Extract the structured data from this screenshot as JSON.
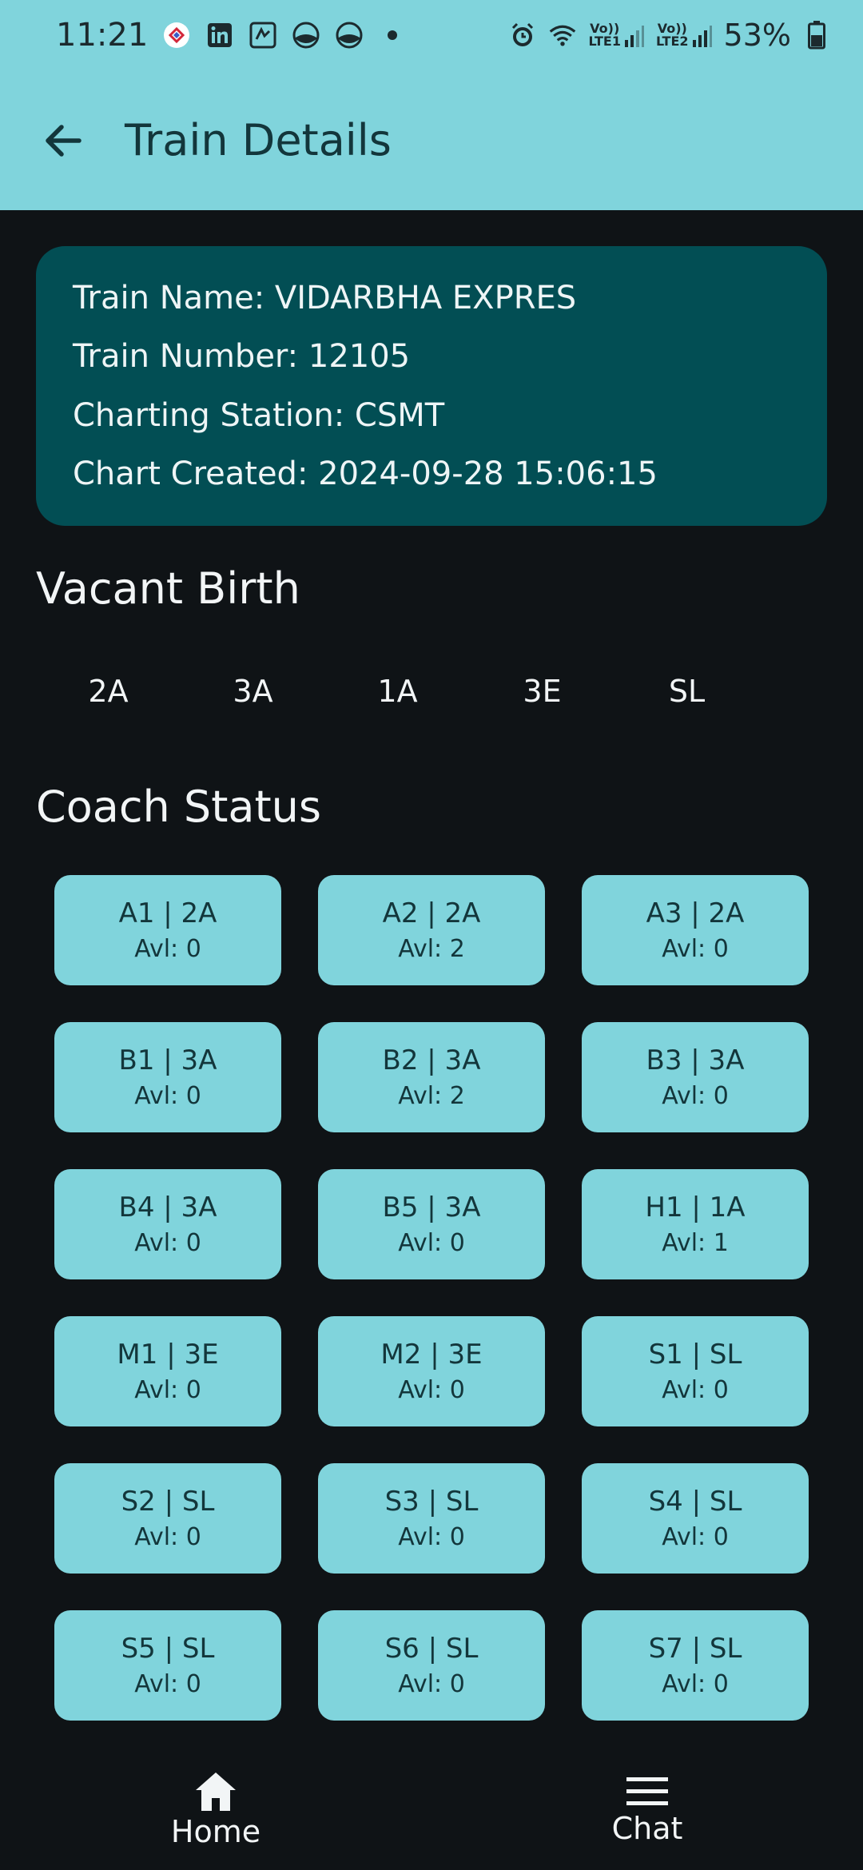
{
  "status_bar": {
    "time": "11:21",
    "battery": "53%",
    "lte1": "LTE1",
    "lte2": "LTE2",
    "vo": "Vo))"
  },
  "app_bar": {
    "title": "Train Details"
  },
  "train_info": {
    "name": "Train Name: VIDARBHA EXPRES",
    "number": "Train Number: 12105",
    "station": "Charting Station: CSMT",
    "created": "Chart Created: 2024-09-28 15:06:15"
  },
  "vacant": {
    "title": "Vacant Birth",
    "tabs": [
      "2A",
      "3A",
      "1A",
      "3E",
      "SL"
    ]
  },
  "coach_status": {
    "title": "Coach Status",
    "coaches": [
      {
        "name": "A1 | 2A",
        "avl": "Avl: 0"
      },
      {
        "name": "A2 | 2A",
        "avl": "Avl: 2"
      },
      {
        "name": "A3 | 2A",
        "avl": "Avl: 0"
      },
      {
        "name": "B1 | 3A",
        "avl": "Avl: 0"
      },
      {
        "name": "B2 | 3A",
        "avl": "Avl: 2"
      },
      {
        "name": "B3 | 3A",
        "avl": "Avl: 0"
      },
      {
        "name": "B4 | 3A",
        "avl": "Avl: 0"
      },
      {
        "name": "B5 | 3A",
        "avl": "Avl: 0"
      },
      {
        "name": "H1 | 1A",
        "avl": "Avl: 1"
      },
      {
        "name": "M1 | 3E",
        "avl": "Avl: 0"
      },
      {
        "name": "M2 | 3E",
        "avl": "Avl: 0"
      },
      {
        "name": "S1 | SL",
        "avl": "Avl: 0"
      },
      {
        "name": "S2 | SL",
        "avl": "Avl: 0"
      },
      {
        "name": "S3 | SL",
        "avl": "Avl: 0"
      },
      {
        "name": "S4 | SL",
        "avl": "Avl: 0"
      },
      {
        "name": "S5 | SL",
        "avl": "Avl: 0"
      },
      {
        "name": "S6 | SL",
        "avl": "Avl: 0"
      },
      {
        "name": "S7 | SL",
        "avl": "Avl: 0"
      }
    ]
  },
  "bottom_nav": {
    "home_label": "Home",
    "chat_label": "Chat"
  },
  "colors": {
    "accent": "#80d4dc",
    "card": "#024e54",
    "background": "#0f1316"
  },
  "icons": {
    "back": "arrow-left-icon",
    "home": "home-icon",
    "chat": "menu-icon"
  }
}
